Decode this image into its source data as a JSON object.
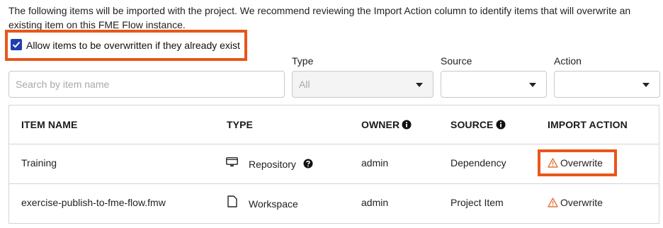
{
  "intro_text": "The following items will be imported with the project. We recommend reviewing the Import Action column to identify items that will overwrite an existing item on this FME Flow instance.",
  "allow_overwrite": {
    "label": "Allow items to be overwritten if they already exist",
    "checked": true
  },
  "filters": {
    "search": {
      "placeholder": "Search by item name",
      "value": ""
    },
    "type": {
      "label": "Type",
      "value": "All"
    },
    "source": {
      "label": "Source",
      "value": ""
    },
    "action": {
      "label": "Action",
      "value": ""
    }
  },
  "table": {
    "headers": {
      "item_name": "ITEM NAME",
      "type": "TYPE",
      "owner": "OWNER",
      "source": "SOURCE",
      "import_action": "IMPORT ACTION"
    },
    "rows": [
      {
        "item_name": "Training",
        "type": "Repository",
        "type_icon": "folder-icon",
        "type_help": "help-icon",
        "owner": "admin",
        "source": "Dependency",
        "import_action": "Overwrite",
        "action_icon": "warning-icon"
      },
      {
        "item_name": "exercise-publish-to-fme-flow.fmw",
        "type": "Workspace",
        "type_icon": "file-icon",
        "owner": "admin",
        "source": "Project Item",
        "import_action": "Overwrite",
        "action_icon": "warning-icon"
      }
    ]
  },
  "colors": {
    "highlight": "#e8561a",
    "checkbox": "#1f3fb0",
    "warning": "#e0793a"
  }
}
